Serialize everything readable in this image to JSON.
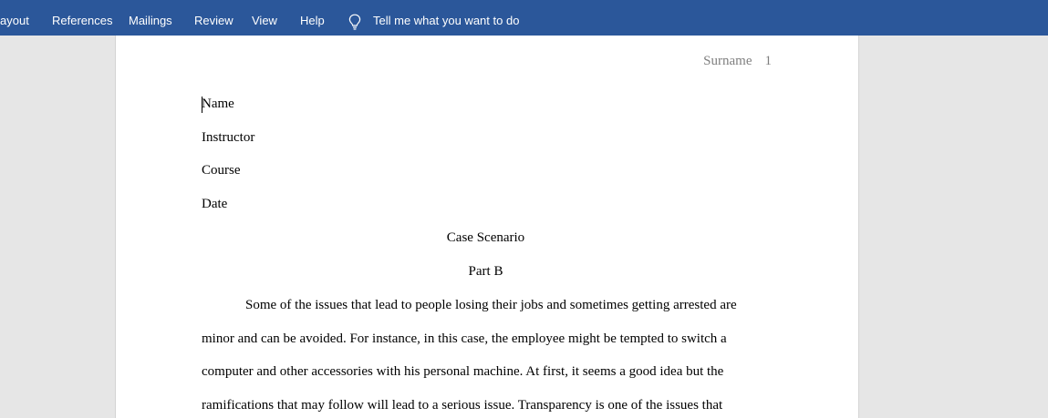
{
  "ribbon": {
    "tabs": [
      {
        "label": "ayout"
      },
      {
        "label": "References"
      },
      {
        "label": "Mailings"
      },
      {
        "label": "Review"
      },
      {
        "label": "View"
      },
      {
        "label": "Help"
      }
    ],
    "tell_me": "Tell me what you want to do",
    "tell_icon": "lightbulb-icon",
    "background_color": "#2b579a"
  },
  "document": {
    "header": {
      "surname": "Surname",
      "page_number": "1"
    },
    "heading_lines": [
      "Name",
      "Instructor",
      "Course",
      "Date"
    ],
    "title": "Case Scenario",
    "subtitle": "Part B",
    "body_lines": [
      "Some of the issues that lead to people losing their jobs and sometimes getting arrested are",
      "minor and can be avoided. For instance, in this case, the employee might be tempted to switch a",
      "computer and other accessories with his personal machine. At first, it seems a good idea but the",
      "ramifications that may follow will lead to a serious issue. Transparency is one of the issues that"
    ]
  }
}
